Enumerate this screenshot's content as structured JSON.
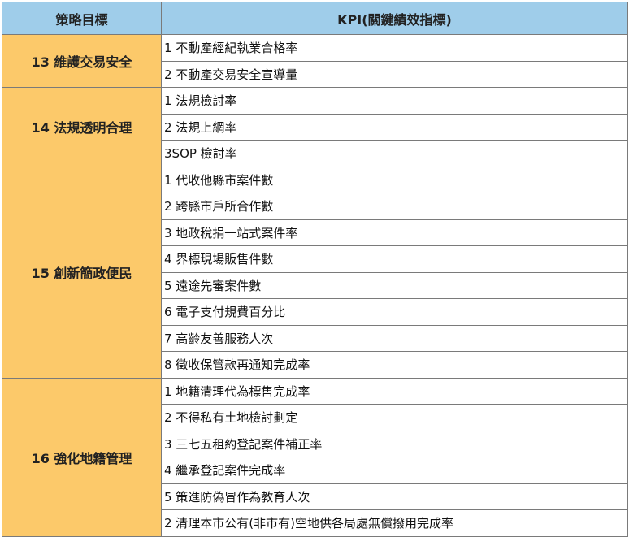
{
  "header": {
    "goal_label": "策略目標",
    "kpi_label": "KPI(關鍵績效指標)"
  },
  "colors": {
    "header_bg": "#9fcdea",
    "goal_bg": "#fcc96a",
    "border": "#7a7a7a"
  },
  "groups": [
    {
      "goal": "13 維護交易安全",
      "kpis": [
        "1 不動產經紀執業合格率",
        "2 不動產交易安全宣導量"
      ]
    },
    {
      "goal": "14 法規透明合理",
      "kpis": [
        "1 法規檢討率",
        "2 法規上網率",
        "3SOP 檢討率"
      ]
    },
    {
      "goal": "15 創新簡政便民",
      "kpis": [
        "1 代收他縣市案件數",
        "2 跨縣市戶所合作數",
        "3 地政稅捐一站式案件率",
        "4 界標現場販售件數",
        "5 遠途先審案件數",
        "6 電子支付規費百分比",
        "7 高齡友善服務人次",
        "8 徵收保管款再通知完成率"
      ]
    },
    {
      "goal": "16 強化地籍管理",
      "kpis": [
        "1 地籍清理代為標售完成率",
        "2 不得私有土地檢討劃定",
        "3 三七五租約登記案件補正率",
        "4 繼承登記案件完成率",
        "5 策進防偽冒作為教育人次",
        "2 清理本市公有(非市有)空地供各局處無償撥用完成率"
      ]
    }
  ]
}
